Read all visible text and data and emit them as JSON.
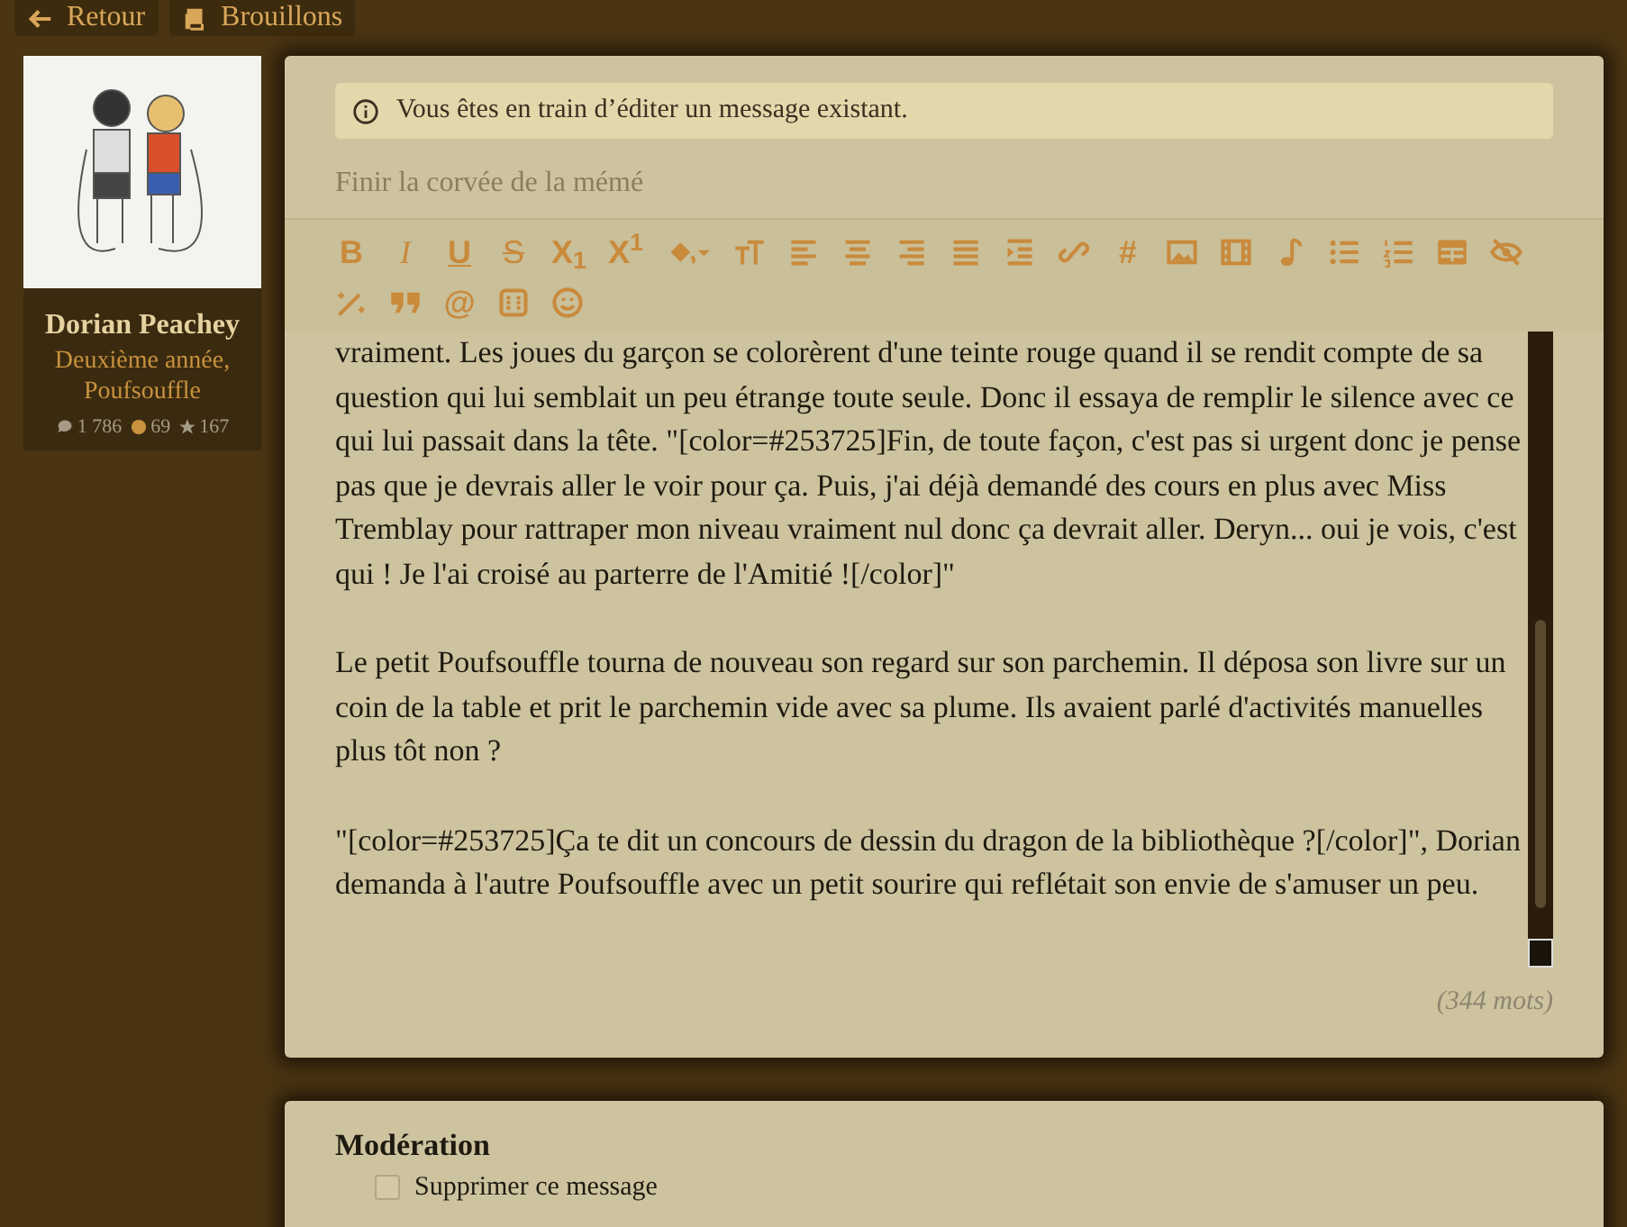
{
  "nav_buttons": [
    {
      "kind": "back",
      "label": "Retour"
    },
    {
      "kind": "drafts",
      "label": "Brouillons"
    }
  ],
  "profile": {
    "name": "Dorian Peachey",
    "subtitle": "Deuxième année, Poufsouffle",
    "stats": [
      {
        "kind": "messages",
        "value": "1 786"
      },
      {
        "kind": "coins",
        "value": "69"
      },
      {
        "kind": "stars",
        "value": "167"
      }
    ]
  },
  "editor": {
    "notice": "Vous êtes en train d’éditer un message existant.",
    "title_field": {
      "placeholder": "Finir la corvée de la mémé"
    },
    "toolbar": [
      {
        "kind": "bold",
        "text": "B"
      },
      {
        "kind": "italic",
        "text": "I"
      },
      {
        "kind": "underline",
        "text": "U"
      },
      {
        "kind": "strike",
        "text": "S"
      },
      {
        "kind": "glyph",
        "text": "X$_{1}$"
      },
      {
        "kind": "glyph",
        "text": "X$^{1}$"
      },
      {
        "kind": "icon"
      },
      {
        "kind": "icon"
      },
      {
        "kind": "icon"
      },
      {
        "kind": "icon"
      },
      {
        "kind": "icon"
      },
      {
        "kind": "icon"
      },
      {
        "kind": "icon"
      },
      {
        "kind": "icon"
      },
      {
        "kind": "glyph",
        "text": "#"
      },
      {
        "kind": "icon"
      },
      {
        "kind": "icon"
      },
      {
        "kind": "icon"
      },
      {
        "kind": "icon"
      },
      {
        "kind": "icon"
      },
      {
        "kind": "icon"
      },
      {
        "kind": "icon"
      },
      {
        "kind": "icon"
      },
      {
        "kind": "icon"
      },
      {
        "kind": "glyph",
        "text": "@"
      },
      {
        "kind": "icon"
      },
      {
        "kind": "icon"
      }
    ],
    "body": [
      "vraiment. Les joues du garçon se colorèrent d'une teinte rouge quand il se rendit compte de sa question qui lui semblait un peu étrange toute seule. Donc il essaya de remplir le silence avec ce qui lui passait dans la tête. \"[color=#253725]Fin, de toute façon, c'est pas si urgent donc je pense pas que je devrais aller le voir pour ça. Puis, j'ai déjà demandé des cours en plus avec Miss Tremblay pour rattraper mon niveau vraiment nul donc ça devrait aller. Deryn... oui je vois, c'est qui ! Je l'ai croisé au parterre de l'Amitié ![/color]\"",
      "Le petit Poufsouffle tourna de nouveau son regard sur son parchemin. Il déposa son livre sur un coin de la table et prit le parchemin vide avec sa plume. Ils avaient parlé d'activités manuelles plus tôt non ?",
      "\"[color=#253725]Ça te dit un concours de dessin du dragon de la bibliothèque ?[/color]\", Dorian demanda à l'autre Poufsouffle avec un petit sourire qui reflétait son envie de s'amuser un peu."
    ],
    "word_count": "(344 mots)"
  },
  "moderation": {
    "title": "Modération",
    "options": [
      {
        "label": "Supprimer ce message",
        "checked": false
      }
    ]
  }
}
